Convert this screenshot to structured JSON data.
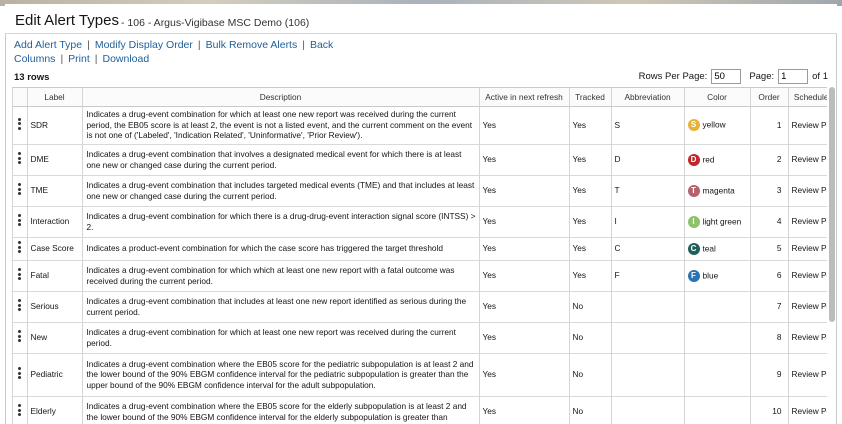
{
  "header": {
    "title": "Edit Alert Types",
    "subtitle": "- 106 - Argus-Vigibase MSC Demo (106)"
  },
  "actions": {
    "add": "Add Alert Type",
    "modify_order": "Modify Display Order",
    "bulk_remove": "Bulk Remove Alerts",
    "back": "Back",
    "columns": "Columns",
    "print": "Print",
    "download": "Download",
    "separator": "|"
  },
  "summary": {
    "row_count": "13 rows"
  },
  "pager": {
    "rows_per_page_label": "Rows Per Page:",
    "rows_per_page": "50",
    "page_label": "Page:",
    "page": "1",
    "of_label": "of 1"
  },
  "table": {
    "columns": [
      "Label",
      "Description",
      "Active in next refresh",
      "Tracked",
      "Abbreviation",
      "Color",
      "Order",
      "Scheduled By"
    ],
    "rows": [
      {
        "label": "SDR",
        "description": "Indicates a drug-event combination for which at least one new report was received during the current period, the EB05 score is at least 2, the event is not a listed event, and the current comment on the event is not one of ('Labeled', 'Indication Related', 'Uninformative', 'Prior Review').",
        "active": "Yes",
        "tracked": "Yes",
        "abbr": "S",
        "color_letter": "S",
        "color_name": "yellow",
        "color_hex": "#e8b23a",
        "order": "1",
        "scheduled": "Review Period"
      },
      {
        "label": "DME",
        "description": "Indicates a drug-event combination that involves a designated medical event for which there is at least one new or changed case during the current period.",
        "active": "Yes",
        "tracked": "Yes",
        "abbr": "D",
        "color_letter": "D",
        "color_name": "red",
        "color_hex": "#c0272d",
        "order": "2",
        "scheduled": "Review Period"
      },
      {
        "label": "TME",
        "description": "Indicates a drug-event combination that includes targeted medical events (TME) and that includes at least one new or changed case during the current period.",
        "active": "Yes",
        "tracked": "Yes",
        "abbr": "T",
        "color_letter": "T",
        "color_name": "magenta",
        "color_hex": "#b5626f",
        "order": "3",
        "scheduled": "Review Period"
      },
      {
        "label": "Interaction",
        "description": "Indicates a drug-event combination for which there is a drug-drug-event interaction signal score (INTSS) > 2.",
        "active": "Yes",
        "tracked": "Yes",
        "abbr": "I",
        "color_letter": "I",
        "color_name": "light green",
        "color_hex": "#8cc26a",
        "order": "4",
        "scheduled": "Review Period"
      },
      {
        "label": "Case Score",
        "description": "Indicates a product-event combination for which the case score has triggered the target threshold",
        "active": "Yes",
        "tracked": "Yes",
        "abbr": "C",
        "color_letter": "C",
        "color_name": "teal",
        "color_hex": "#1f5f5b",
        "order": "5",
        "scheduled": "Review Period"
      },
      {
        "label": "Fatal",
        "description": "Indicates a drug-event combination for which which at least one new report with a fatal outcome was received during the current period.",
        "active": "Yes",
        "tracked": "Yes",
        "abbr": "F",
        "color_letter": "F",
        "color_name": "blue",
        "color_hex": "#2a73b5",
        "order": "6",
        "scheduled": "Review Period"
      },
      {
        "label": "Serious",
        "description": "Indicates a drug-event combination that includes at least one new report identified as serious during the current period.",
        "active": "Yes",
        "tracked": "No",
        "abbr": "",
        "color_letter": "",
        "color_name": "",
        "color_hex": "",
        "order": "7",
        "scheduled": "Review Period"
      },
      {
        "label": "New",
        "description": "Indicates a drug-event combination for which at least one new report was received during the current period.",
        "active": "Yes",
        "tracked": "No",
        "abbr": "",
        "color_letter": "",
        "color_name": "",
        "color_hex": "",
        "order": "8",
        "scheduled": "Review Period"
      },
      {
        "label": "Pediatric",
        "description": "Indicates a drug-event combination where the EB05 score for the pediatric subpopulation is at least 2 and the lower bound of the 90% EBGM confidence interval for the pediatric subpopulation is greater than the upper bound of the 90% EBGM confidence interval for the adult subpopulation.",
        "active": "Yes",
        "tracked": "No",
        "abbr": "",
        "color_letter": "",
        "color_name": "",
        "color_hex": "",
        "order": "9",
        "scheduled": "Review Period"
      },
      {
        "label": "Elderly",
        "description": "Indicates a drug-event combination where the EB05 score for the elderly subpopulation is at least 2 and the lower bound of the 90% EBGM confidence interval for the elderly subpopulation is greater than",
        "active": "Yes",
        "tracked": "No",
        "abbr": "",
        "color_letter": "",
        "color_name": "",
        "color_hex": "",
        "order": "10",
        "scheduled": "Review Period"
      }
    ]
  }
}
